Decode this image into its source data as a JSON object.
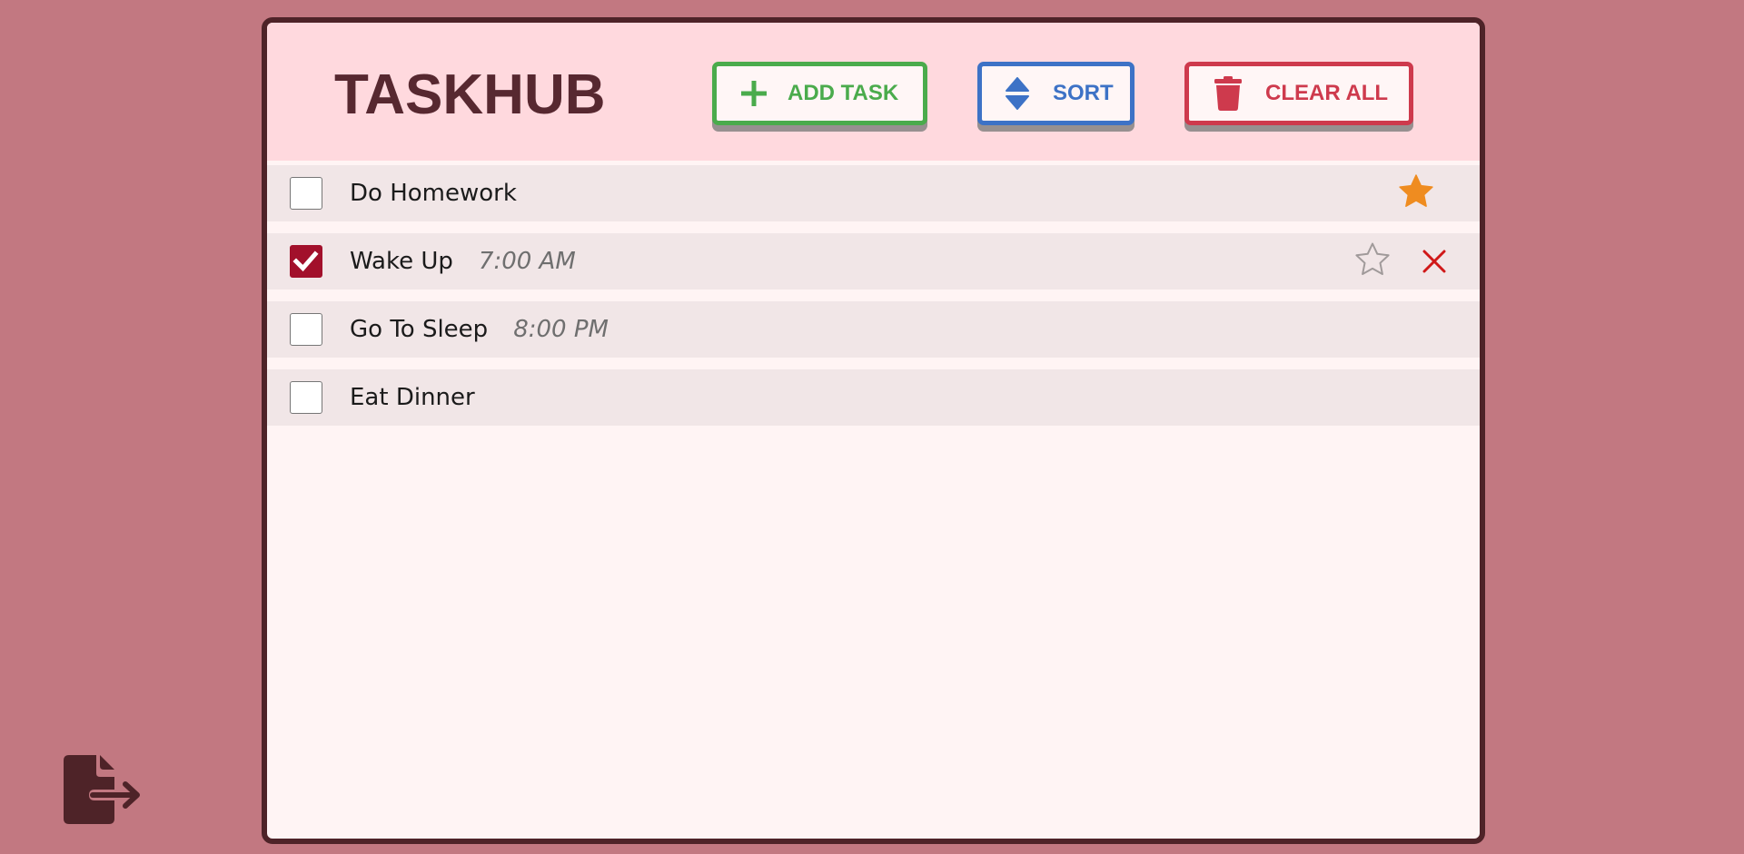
{
  "app": {
    "title": "TASKHUB"
  },
  "toolbar": {
    "add_label": "ADD TASK",
    "sort_label": "SORT",
    "clear_label": "CLEAR ALL"
  },
  "tasks": [
    {
      "name": "Do Homework",
      "time": "",
      "completed": false,
      "starred": true,
      "show_star": true,
      "show_delete": false
    },
    {
      "name": "Wake Up",
      "time": "7:00 AM",
      "completed": true,
      "starred": false,
      "show_star": true,
      "show_delete": true
    },
    {
      "name": "Go To Sleep",
      "time": "8:00 PM",
      "completed": false,
      "starred": false,
      "show_star": false,
      "show_delete": false
    },
    {
      "name": "Eat Dinner",
      "time": "",
      "completed": false,
      "starred": false,
      "show_star": false,
      "show_delete": false
    }
  ],
  "icons": {
    "add": "plus-icon",
    "sort": "sort-icon",
    "clear": "trash-icon",
    "star_filled": "star-filled-icon",
    "star_outline": "star-outline-icon",
    "delete": "close-icon",
    "export": "file-export-icon",
    "check": "checkmark-icon"
  },
  "colors": {
    "page_background": "#c27881",
    "panel_border": "#4e2328",
    "header_background": "#ffd9de",
    "title": "#572830",
    "add": "#4aab4c",
    "sort": "#3d72c6",
    "clear": "#ce3a4d",
    "checked": "#a2102b",
    "star_filled": "#ef8c20",
    "star_outline": "#a09a9a",
    "delete": "#d01818",
    "export": "#4e2328"
  }
}
